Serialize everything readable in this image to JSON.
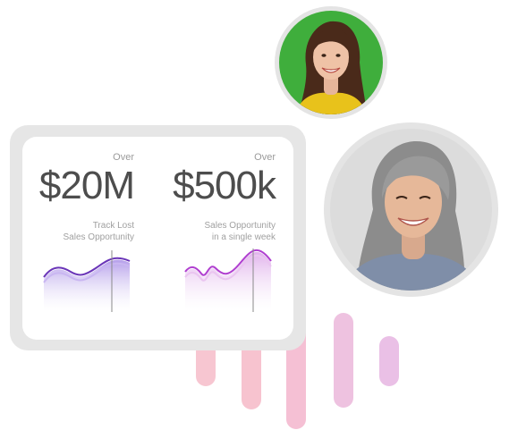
{
  "stats": [
    {
      "over_label": "Over",
      "value": "$20M",
      "caption_line1": "Track Lost",
      "caption_line2": "Sales Opportunity"
    },
    {
      "over_label": "Over",
      "value": "$500k",
      "caption_line1": "Sales Opportunity",
      "caption_line2": "in a single week"
    }
  ],
  "colors": {
    "card_border": "#e6e6e6",
    "chart1_line": "#6a35b8",
    "chart1_fill": "#a88ee6",
    "chart2_line": "#b03fd0",
    "chart2_fill": "#dba4e8",
    "bar_pink": "#f7c3cf",
    "bar_lilac": "#eac0e6",
    "avatar1_bg": "#3fae3c",
    "avatar2_bg": "#dcdcdc"
  },
  "avatars": [
    {
      "icon": "woman-portrait-icon"
    },
    {
      "icon": "woman-portrait-icon"
    }
  ]
}
